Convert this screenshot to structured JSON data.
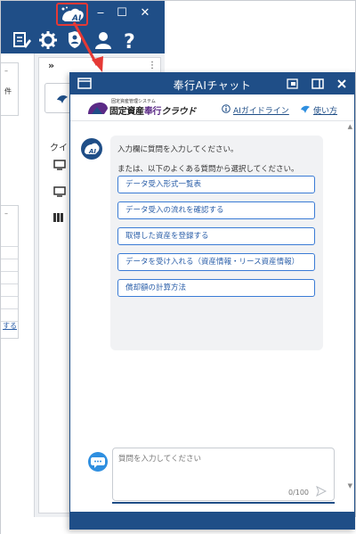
{
  "background_app": {
    "window_controls": {
      "minimize": "‒",
      "maximize": "☐",
      "close": "✕"
    },
    "left_panel": {
      "text_item": "件",
      "link_text": "する"
    },
    "center": {
      "expand": "»",
      "menu": "⋮",
      "quick_label": "クイ"
    }
  },
  "chat": {
    "title": "奉行AIチャット",
    "brand": {
      "small": "固定資産管理システム",
      "main_a": "固定資産",
      "main_b": "奉行",
      "main_c": "クラウド"
    },
    "links": {
      "guideline": "AIガイドライン",
      "howto": "使い方"
    },
    "message": {
      "line1": "入力欄に質問を入力してください。",
      "line2": "または、以下のよくある質問から選択してください。"
    },
    "questions": [
      "データ受入形式一覧表",
      "データ受入の流れを確認する",
      "取得した資産を登録する",
      "データを受け入れる（資産情報・リース資産情報）",
      "償却額の計算方法"
    ],
    "input": {
      "placeholder": "質問を入力してください",
      "counter": "0/100"
    }
  },
  "colors": {
    "primary": "#1f4e87",
    "accent_red": "#e53935",
    "link_blue": "#2a5ea8",
    "bubble_bg": "#f1f2f4"
  }
}
